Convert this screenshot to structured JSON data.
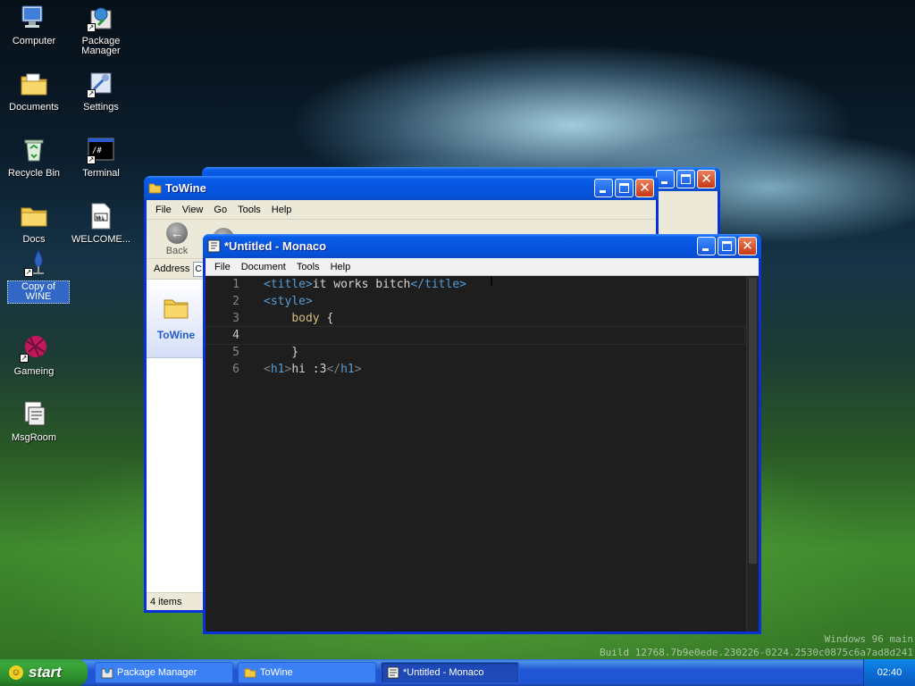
{
  "desktop": {
    "icons": [
      {
        "label": "Computer"
      },
      {
        "label": "Package Manager"
      },
      {
        "label": "Documents"
      },
      {
        "label": "Settings"
      },
      {
        "label": "Recycle Bin"
      },
      {
        "label": "Terminal"
      },
      {
        "label": "Docs"
      },
      {
        "label": "WELCOME..."
      },
      {
        "label": "Copy of WINE"
      },
      {
        "label": "Gameing"
      },
      {
        "label": "MsgRoom"
      }
    ],
    "version_line1": "Windows 96 main",
    "version_line2": "Build 12768.7b9e0ede.230226-0224.2530c0875c6a7ad8d241"
  },
  "explorer": {
    "title": "ToWine",
    "menu": [
      "File",
      "View",
      "Go",
      "Tools",
      "Help"
    ],
    "back_label": "Back",
    "address_label": "Address",
    "address_value": "C",
    "folder_label": "ToWine",
    "status": "4 items"
  },
  "editor": {
    "title": "*Untitled - Monaco",
    "menu": [
      "File",
      "Document",
      "Tools",
      "Help"
    ],
    "line_numbers": [
      "1",
      "2",
      "3",
      "4",
      "5",
      "6"
    ],
    "active_line": 4,
    "code": {
      "l1_open": "<title>",
      "l1_text": "it works bitch",
      "l1_close": "</title>",
      "l2": "<style>",
      "l3_indent": "    ",
      "l3_sel": "body",
      "l3_brace": " {",
      "l5_brace": "    }",
      "l6_open_a": "<",
      "l6_open_tag": "h1",
      "l6_open_b": ">",
      "l6_text": "hi :3",
      "l6_close_a": "</",
      "l6_close_tag": "h1",
      "l6_close_b": ">"
    }
  },
  "taskbar": {
    "start_label": "start",
    "tasks": [
      {
        "label": "Package Manager",
        "active": false
      },
      {
        "label": "ToWine",
        "active": false
      },
      {
        "label": "*Untitled - Monaco",
        "active": true
      }
    ],
    "clock": "02:40"
  },
  "colors": {
    "titlebar_blue": "#0654e0",
    "editor_bg": "#1e1e1e",
    "tag_blue": "#569cd6",
    "start_green": "#3aa83a"
  }
}
